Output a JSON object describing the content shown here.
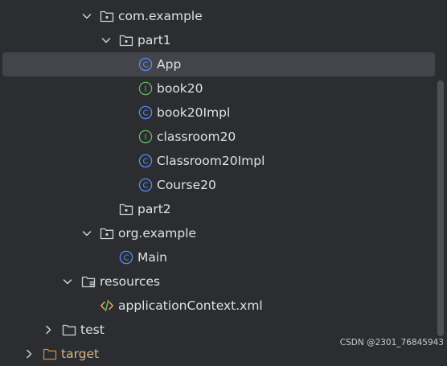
{
  "tree": {
    "com_example": {
      "label": "com.example",
      "expanded": true
    },
    "part1": {
      "label": "part1",
      "expanded": true
    },
    "app": {
      "label": "App",
      "kind": "class",
      "selected": true
    },
    "book20": {
      "label": "book20",
      "kind": "interface"
    },
    "book20impl": {
      "label": "book20Impl",
      "kind": "class"
    },
    "classroom20": {
      "label": "classroom20",
      "kind": "interface"
    },
    "classroom20impl": {
      "label": "Classroom20Impl",
      "kind": "class"
    },
    "course20": {
      "label": "Course20",
      "kind": "class"
    },
    "part2": {
      "label": "part2",
      "expanded": false
    },
    "org_example": {
      "label": "org.example",
      "expanded": true
    },
    "main": {
      "label": "Main",
      "kind": "class"
    },
    "resources": {
      "label": "resources",
      "expanded": true
    },
    "application_context": {
      "label": "applicationContext.xml",
      "kind": "xml"
    },
    "test": {
      "label": "test",
      "expanded": false
    },
    "target": {
      "label": "target",
      "expanded": false
    }
  },
  "icons": {
    "class": "C",
    "interface": "I"
  },
  "colors": {
    "background": "#2b2d30",
    "selection": "#43454a",
    "class_icon": "#548af7",
    "interface_icon": "#5fb865",
    "folder_icon": "#ced0d6",
    "target_folder": "#c4874f",
    "xml_icon_tag": "#e8a85a",
    "xml_icon_slash": "#6fbf73"
  },
  "watermark": "CSDN @2301_76845943"
}
